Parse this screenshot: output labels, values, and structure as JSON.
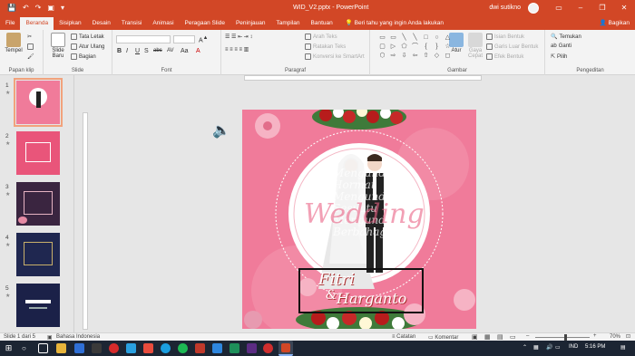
{
  "window": {
    "title": "WID_V2.pptx  -  PowerPoint",
    "user": "dwi sutikno",
    "qat": [
      "💾",
      "↶",
      "↷",
      "▣",
      "▾"
    ],
    "controls": [
      "▭",
      "–",
      "❐",
      "✕"
    ]
  },
  "tabs": [
    "File",
    "Beranda",
    "Sisipkan",
    "Desain",
    "Transisi",
    "Animasi",
    "Peragaan Slide",
    "Peninjauan",
    "Tampilan",
    "Bantuan"
  ],
  "active_tab": "Beranda",
  "tellme": "Beri tahu yang ingin Anda lakukan",
  "share": "Bagikan",
  "ribbon": {
    "clipboard": {
      "label": "Papan klip",
      "paste": "Tempel"
    },
    "slides": {
      "label": "Slide",
      "new_slide": "Slide Baru",
      "layout": "Tata Letak",
      "reset": "Atur Ulang",
      "section": "Bagian"
    },
    "font": {
      "label": "Font",
      "buttons": [
        "B",
        "I",
        "U",
        "S",
        "abc",
        "AV",
        "Aa",
        "A"
      ]
    },
    "paragraph": {
      "label": "Paragraf",
      "text_direction": "Arah Teks",
      "align_text": "Ratakan Teks",
      "smartart": "Konversi ke SmartArt"
    },
    "drawing": {
      "label": "Gambar",
      "arrange": "Atur",
      "quick_styles": "Gaya Cepat",
      "fill": "Isian Bentuk",
      "outline": "Garis Luar Bentuk",
      "effects": "Efek Bentuk",
      "shapes": [
        "▭",
        "▭",
        "╲",
        "╲",
        "□",
        "○",
        "△",
        "▢",
        "▷",
        "⬠",
        "⌒",
        "{",
        "}",
        "☆",
        "⬡",
        "⇨",
        "⇩",
        "⇦",
        "⇧",
        "◇",
        "◻"
      ]
    },
    "editing": {
      "label": "Pengeditan",
      "find": "Temukan",
      "replace": "Ganti",
      "select": "Pilih"
    }
  },
  "thumbnails": [
    {
      "num": "1",
      "star": "★"
    },
    {
      "num": "2",
      "star": "★"
    },
    {
      "num": "3",
      "star": "★"
    },
    {
      "num": "4",
      "star": "★"
    },
    {
      "num": "5",
      "star": "★"
    }
  ],
  "slide": {
    "names": "Fitri",
    "amp": "&",
    "groom": "Harganto",
    "ghost_text": [
      "Mengundang",
      "Hormat",
      "Mengundang",
      "Sesuatu",
      "Mengundang",
      "Berbahagia"
    ],
    "wedding": "Wedding"
  },
  "status": {
    "slide_info": "Slide 1 dari 5",
    "language": "Bahasa Indonesia",
    "notes": "Catatan",
    "comments": "Komentar",
    "zoom": "70%"
  },
  "taskbar": {
    "lang": "IND",
    "time": "5:16 PM"
  },
  "colors": {
    "accent": "#d24726",
    "slide_bg": "#f07b9a",
    "thumb_selected": "#f2a27c"
  }
}
